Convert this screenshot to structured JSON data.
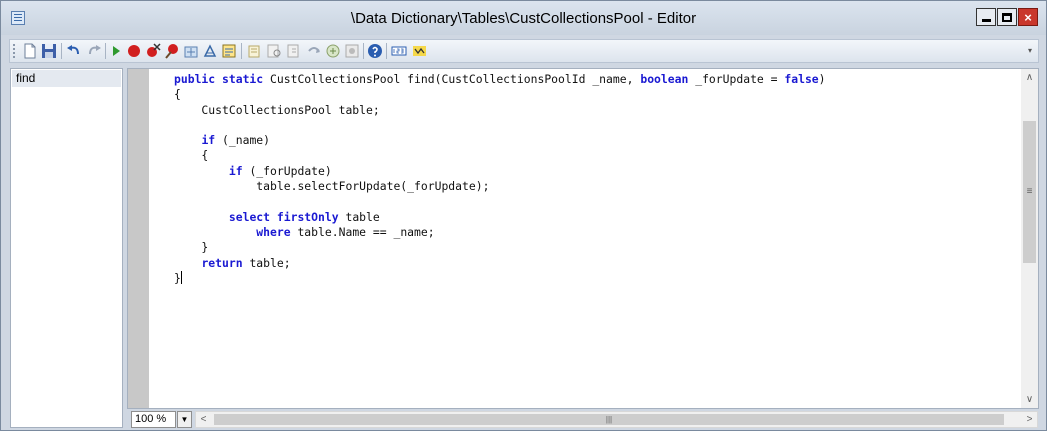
{
  "window": {
    "title": "\\Data Dictionary\\Tables\\CustCollectionsPool - Editor",
    "close_glyph": "×"
  },
  "toolbar": {
    "icons": [
      "new-icon",
      "save-icon",
      "undo-icon",
      "redo-icon",
      "run-icon",
      "breakpoint-icon",
      "remove-breakpoints-icon",
      "enable-breakpoint-icon",
      "compile-icon",
      "lookup-icon",
      "scripts-icon",
      "source-control-icon",
      "find-icon",
      "replace-icon",
      "go-to-icon",
      "properties-icon",
      "help-icon",
      "numbers-icon",
      "label-icon"
    ]
  },
  "methods": {
    "items": [
      {
        "label": "find"
      }
    ]
  },
  "editor": {
    "code_lines": [
      [
        {
          "t": "public static ",
          "k": true
        },
        {
          "t": "CustCollectionsPool find(CustCollectionsPoolId _name, "
        },
        {
          "t": "boolean",
          "k": true
        },
        {
          "t": " _forUpdate = "
        },
        {
          "t": "false",
          "k": true
        },
        {
          "t": ")"
        }
      ],
      [
        {
          "t": "{"
        }
      ],
      [
        {
          "t": "    CustCollectionsPool table;"
        }
      ],
      [
        {
          "t": ""
        }
      ],
      [
        {
          "t": "    "
        },
        {
          "t": "if",
          "k": true
        },
        {
          "t": " (_name)"
        }
      ],
      [
        {
          "t": "    {"
        }
      ],
      [
        {
          "t": "        "
        },
        {
          "t": "if",
          "k": true
        },
        {
          "t": " (_forUpdate)"
        }
      ],
      [
        {
          "t": "            table.selectForUpdate(_forUpdate);"
        }
      ],
      [
        {
          "t": ""
        }
      ],
      [
        {
          "t": "        "
        },
        {
          "t": "select firstOnly",
          "k": true
        },
        {
          "t": " table"
        }
      ],
      [
        {
          "t": "            "
        },
        {
          "t": "where",
          "k": true
        },
        {
          "t": " table.Name == _name;"
        }
      ],
      [
        {
          "t": "    }"
        }
      ],
      [
        {
          "t": "    "
        },
        {
          "t": "return",
          "k": true
        },
        {
          "t": " table;"
        }
      ],
      [
        {
          "t": "}"
        }
      ]
    ],
    "keyword_color": "#1a19d2"
  },
  "status": {
    "zoom": "100 %"
  }
}
